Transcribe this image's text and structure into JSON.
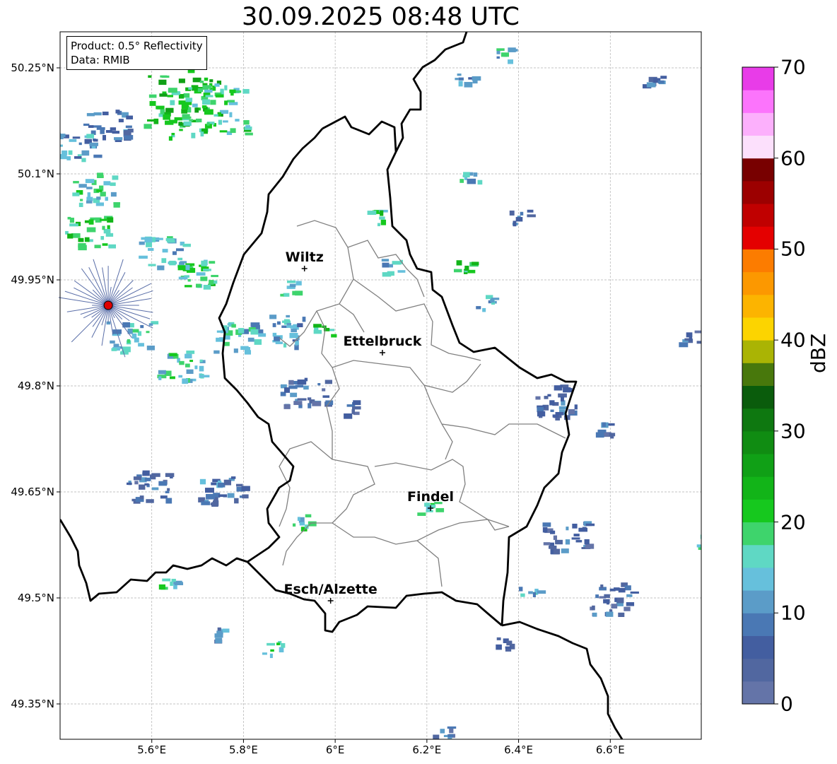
{
  "title": "30.09.2025 08:48 UTC",
  "info": {
    "product": "Product: 0.5° Reflectivity",
    "source": "Data: RMIB"
  },
  "axes": {
    "lat_labels": [
      "50.25°N",
      "50.1°N",
      "49.95°N",
      "49.8°N",
      "49.65°N",
      "49.5°N",
      "49.35°N"
    ],
    "lat_values": [
      50.25,
      50.1,
      49.95,
      49.8,
      49.65,
      49.5,
      49.35
    ],
    "lon_labels": [
      "5.6°E",
      "5.8°E",
      "6°E",
      "6.2°E",
      "6.4°E",
      "6.6°E"
    ],
    "lon_values": [
      5.6,
      5.8,
      6.0,
      6.2,
      6.4,
      6.6
    ],
    "lon_range": [
      5.4,
      6.8
    ],
    "lat_range": [
      49.3,
      50.3
    ],
    "grid": true
  },
  "radar_site": {
    "lon": 5.505,
    "lat": 49.914,
    "color": "#e00000"
  },
  "cities": [
    {
      "name": "Wiltz",
      "lon": 5.933,
      "lat": 49.966
    },
    {
      "name": "Ettelbruck",
      "lon": 6.103,
      "lat": 49.847
    },
    {
      "name": "Findel",
      "lon": 6.208,
      "lat": 49.627
    },
    {
      "name": "Esch/Alzette",
      "lon": 5.99,
      "lat": 49.496
    }
  ],
  "colorbar": {
    "label": "dBZ",
    "ticks": [
      0,
      10,
      20,
      30,
      40,
      50,
      60,
      70
    ],
    "tick_labels": [
      "0",
      "10",
      "20",
      "30",
      "40",
      "50",
      "60",
      "70"
    ],
    "range": [
      0,
      70
    ],
    "step": 2.5,
    "colors": [
      "#6474a8",
      "#5167a0",
      "#435ea0",
      "#4a78b4",
      "#5b9cc8",
      "#66c0dc",
      "#5fd8c4",
      "#3ed46c",
      "#16c81e",
      "#12b418",
      "#10a016",
      "#108c12",
      "#0e7810",
      "#0a5c0c",
      "#48780c",
      "#aab404",
      "#fcd400",
      "#fcb400",
      "#fc9800",
      "#fc7c00",
      "#e40000",
      "#c00000",
      "#9c0000",
      "#780000",
      "#fce0fc",
      "#fcb0fc",
      "#fc74fc",
      "#e83ce8"
    ]
  },
  "echoes": [
    {
      "lon": 5.66,
      "lat": 50.21,
      "dbz": 22,
      "size": "large"
    },
    {
      "lon": 5.72,
      "lat": 50.19,
      "dbz": 18,
      "size": "large"
    },
    {
      "lon": 5.5,
      "lat": 50.17,
      "dbz": 8,
      "size": "medium"
    },
    {
      "lon": 5.43,
      "lat": 50.14,
      "dbz": 12,
      "size": "medium"
    },
    {
      "lon": 5.47,
      "lat": 50.08,
      "dbz": 16,
      "size": "medium"
    },
    {
      "lon": 5.46,
      "lat": 50.02,
      "dbz": 20,
      "size": "medium"
    },
    {
      "lon": 5.62,
      "lat": 49.99,
      "dbz": 14,
      "size": "medium"
    },
    {
      "lon": 5.68,
      "lat": 49.96,
      "dbz": 18,
      "size": "medium"
    },
    {
      "lon": 5.55,
      "lat": 49.87,
      "dbz": 14,
      "size": "medium"
    },
    {
      "lon": 5.66,
      "lat": 49.83,
      "dbz": 16,
      "size": "medium"
    },
    {
      "lon": 5.78,
      "lat": 49.87,
      "dbz": 14,
      "size": "medium"
    },
    {
      "lon": 5.88,
      "lat": 49.88,
      "dbz": 12,
      "size": "medium"
    },
    {
      "lon": 5.97,
      "lat": 49.88,
      "dbz": 20,
      "size": "small"
    },
    {
      "lon": 5.93,
      "lat": 49.79,
      "dbz": 6,
      "size": "medium"
    },
    {
      "lon": 6.02,
      "lat": 49.77,
      "dbz": 6,
      "size": "small"
    },
    {
      "lon": 5.9,
      "lat": 49.94,
      "dbz": 16,
      "size": "small"
    },
    {
      "lon": 6.12,
      "lat": 49.97,
      "dbz": 14,
      "size": "small"
    },
    {
      "lon": 6.08,
      "lat": 50.04,
      "dbz": 18,
      "size": "small"
    },
    {
      "lon": 6.28,
      "lat": 49.97,
      "dbz": 20,
      "size": "small"
    },
    {
      "lon": 6.32,
      "lat": 49.92,
      "dbz": 12,
      "size": "small"
    },
    {
      "lon": 6.48,
      "lat": 49.78,
      "dbz": 6,
      "size": "medium"
    },
    {
      "lon": 6.58,
      "lat": 49.74,
      "dbz": 6,
      "size": "small"
    },
    {
      "lon": 6.2,
      "lat": 49.63,
      "dbz": 16,
      "size": "small"
    },
    {
      "lon": 6.5,
      "lat": 49.59,
      "dbz": 6,
      "size": "medium"
    },
    {
      "lon": 6.6,
      "lat": 49.5,
      "dbz": 6,
      "size": "medium"
    },
    {
      "lon": 6.42,
      "lat": 49.51,
      "dbz": 14,
      "size": "small"
    },
    {
      "lon": 6.36,
      "lat": 49.44,
      "dbz": 6,
      "size": "small"
    },
    {
      "lon": 6.23,
      "lat": 49.31,
      "dbz": 6,
      "size": "small"
    },
    {
      "lon": 5.86,
      "lat": 49.43,
      "dbz": 18,
      "size": "small"
    },
    {
      "lon": 5.75,
      "lat": 49.45,
      "dbz": 8,
      "size": "small"
    },
    {
      "lon": 5.63,
      "lat": 49.52,
      "dbz": 16,
      "size": "small"
    },
    {
      "lon": 5.59,
      "lat": 49.66,
      "dbz": 6,
      "size": "medium"
    },
    {
      "lon": 5.75,
      "lat": 49.65,
      "dbz": 8,
      "size": "medium"
    },
    {
      "lon": 5.92,
      "lat": 49.61,
      "dbz": 16,
      "size": "small"
    },
    {
      "lon": 6.28,
      "lat": 50.24,
      "dbz": 10,
      "size": "small"
    },
    {
      "lon": 6.36,
      "lat": 50.27,
      "dbz": 14,
      "size": "small"
    },
    {
      "lon": 6.77,
      "lat": 49.87,
      "dbz": 6,
      "size": "small"
    },
    {
      "lon": 6.79,
      "lat": 49.58,
      "dbz": 16,
      "size": "small"
    },
    {
      "lon": 6.69,
      "lat": 50.23,
      "dbz": 6,
      "size": "small"
    },
    {
      "lon": 6.4,
      "lat": 50.04,
      "dbz": 8,
      "size": "small"
    },
    {
      "lon": 6.29,
      "lat": 50.1,
      "dbz": 14,
      "size": "small"
    }
  ]
}
